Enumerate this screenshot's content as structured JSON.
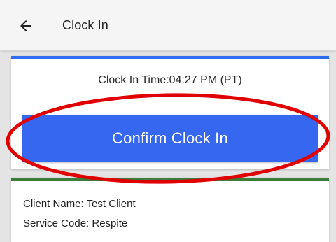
{
  "header": {
    "back_icon": "arrow-left-icon",
    "title": "Clock In"
  },
  "clock_card": {
    "accent_color": "#2f6ef0",
    "clock_in_time": "Clock In Time:04:27 PM (PT)",
    "confirm_label": "Confirm Clock In",
    "button_color": "#3567f0"
  },
  "client_card": {
    "accent_color": "#3c7d3c",
    "client_name": "Client Name: Test Client",
    "service_code": "Service Code: Respite"
  },
  "annotation": {
    "highlight_color": "#e00000"
  }
}
